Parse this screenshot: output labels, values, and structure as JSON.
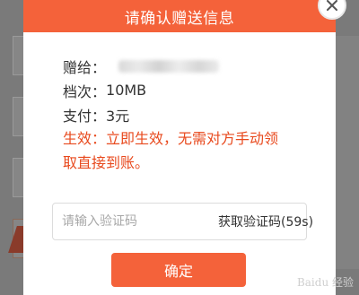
{
  "dialog": {
    "title": "请确认赠送信息",
    "recipient_label": "赠给：",
    "tier_label": "档次：",
    "tier_value": "10MB",
    "payment_label": "支付：",
    "payment_value": "3元",
    "notice": "生效：立即生效，无需对方手动领取直接到账。",
    "code_placeholder": "请输入验证码",
    "get_code_label": "获取验证码(59s)",
    "confirm_label": "确定"
  },
  "watermark": "Baidu 经验",
  "colors": {
    "accent": "#f4623a",
    "notice": "#e8491d"
  },
  "icons": {
    "close": "close-icon"
  }
}
